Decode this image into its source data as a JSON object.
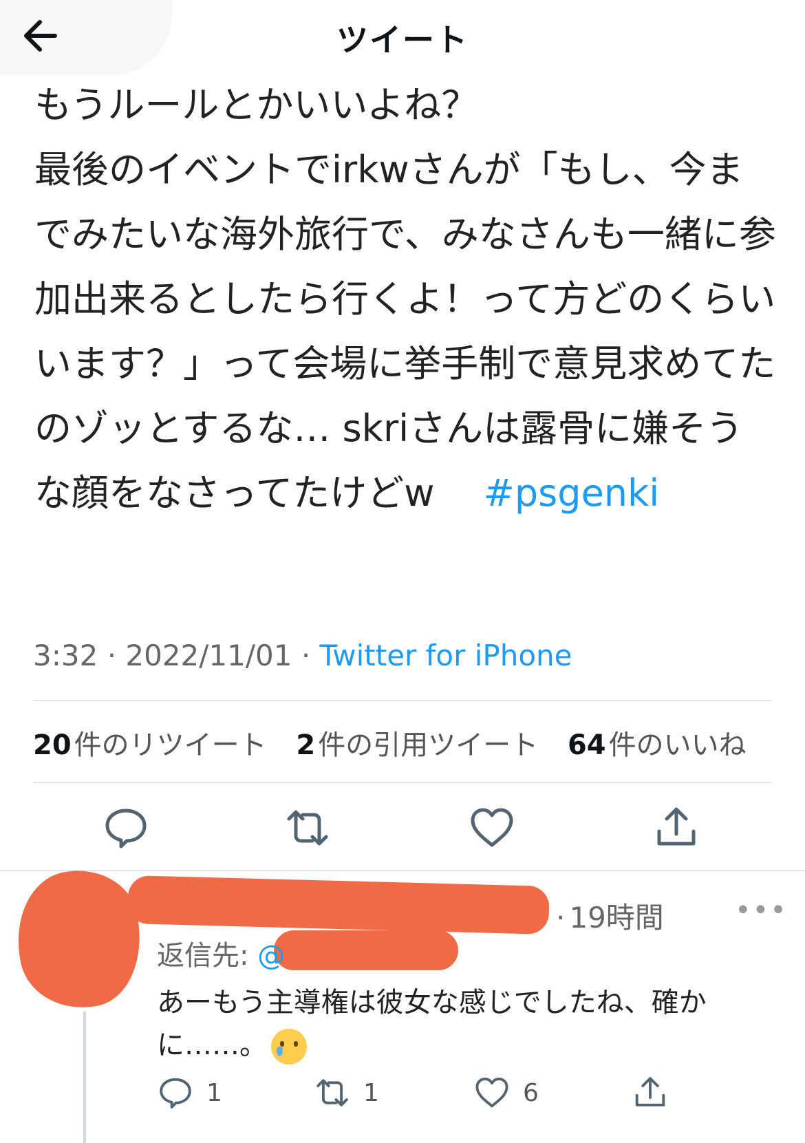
{
  "header": {
    "title": "ツイート"
  },
  "tweet": {
    "text": "もうルールとかいいよね？\n最後のイベントでirkwさんが「もし、今までみたいな海外旅行で、みなさんも一緒に参加出来るとしたら行くよ！って方どのくらいいます？」って会場に挙手制で意見求めてたのゾッとするな… skriさんは露骨に嫌そうな顔をなさってたけどw　 ",
    "hashtag": "#psgenki",
    "time": "3:32",
    "date": "2022/11/01",
    "source": "Twitter for iPhone",
    "stats": {
      "retweets_count": "20",
      "retweets_label": "件のリツイート",
      "quotes_count": "2",
      "quotes_label": "件の引用ツイート",
      "likes_count": "64",
      "likes_label": "件のいいね"
    }
  },
  "reply": {
    "time": "19時間",
    "reply_to_label": "返信先:",
    "reply_to_handle": "@",
    "text": "あーもう主導権は彼女な感じでしたね、確かに……。",
    "emoji": "crying-face",
    "reply_count": "1",
    "retweet_count": "1",
    "like_count": "6"
  },
  "icons": {
    "back": "arrow-left-icon",
    "reply": "speech-bubble-icon",
    "retweet": "retweet-arrows-icon",
    "like": "heart-icon",
    "share": "share-upload-icon",
    "more": "more-dots-icon"
  },
  "colors": {
    "accent": "#1d9bf0",
    "redaction": "#f06a45",
    "text": "#0f1419",
    "secondary": "#666666"
  }
}
